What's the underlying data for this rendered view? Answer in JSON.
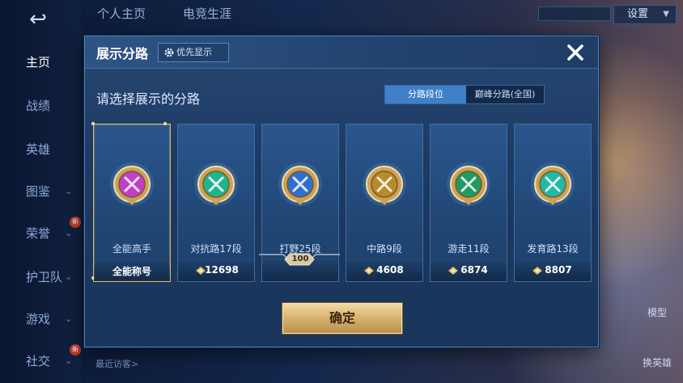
{
  "background": {
    "back_icon": "back-arrow-icon",
    "nav": {
      "items": [
        {
          "label": "主页",
          "active": true,
          "has_chevron": false,
          "badge": ""
        },
        {
          "label": "战绩",
          "active": false,
          "has_chevron": false,
          "badge": ""
        },
        {
          "label": "英雄",
          "active": false,
          "has_chevron": false,
          "badge": ""
        },
        {
          "label": "图鉴",
          "active": false,
          "has_chevron": true,
          "badge": ""
        },
        {
          "label": "荣誉",
          "active": false,
          "has_chevron": true,
          "badge": "新"
        },
        {
          "label": "护卫队",
          "active": false,
          "has_chevron": true,
          "badge": ""
        },
        {
          "label": "游戏",
          "active": false,
          "has_chevron": true,
          "badge": ""
        },
        {
          "label": "社交",
          "active": false,
          "has_chevron": true,
          "badge": "新"
        }
      ]
    },
    "top_tabs": [
      "个人主页",
      "电竞生涯"
    ],
    "settings_label": "设置",
    "recent_visitors_label": "最近访客>",
    "right_labels": [
      "模型",
      "换英雄"
    ]
  },
  "modal": {
    "title": "展示分路",
    "priority_button_label": "优先显示",
    "priority_icon": "gear-icon",
    "close_icon": "close-icon",
    "subtitle": "请选择展示的分路",
    "toggle": {
      "options": [
        "分路段位",
        "巅峰分路(全国)"
      ],
      "selected_index": 0
    },
    "cards": [
      {
        "rank": "全能高手",
        "footer": "全能称号",
        "score": "",
        "selected": true,
        "badge_icon": "all-round-badge-icon",
        "badge_color": "#c13fc9"
      },
      {
        "rank": "对抗路17段",
        "footer": "",
        "score": "12698",
        "selected": false,
        "badge_icon": "clash-lane-badge-icon",
        "badge_color": "#1fb58c"
      },
      {
        "rank": "打野25段",
        "footer": "",
        "score": "",
        "level": "100",
        "selected": false,
        "badge_icon": "jungle-badge-icon",
        "badge_color": "#2f6fd1"
      },
      {
        "rank": "中路9段",
        "footer": "",
        "score": "4608",
        "selected": false,
        "badge_icon": "mid-lane-badge-icon",
        "badge_color": "#b98a2a"
      },
      {
        "rank": "游走11段",
        "footer": "",
        "score": "6874",
        "selected": false,
        "badge_icon": "roam-badge-icon",
        "badge_color": "#1f9a62"
      },
      {
        "rank": "发育路13段",
        "footer": "",
        "score": "8807",
        "selected": false,
        "badge_icon": "farm-lane-badge-icon",
        "badge_color": "#23b7a6"
      }
    ],
    "confirm_label": "确定"
  },
  "colors": {
    "accent_blue": "#3f80c8",
    "gold": "#d8b66a",
    "panel": "#22436f"
  }
}
